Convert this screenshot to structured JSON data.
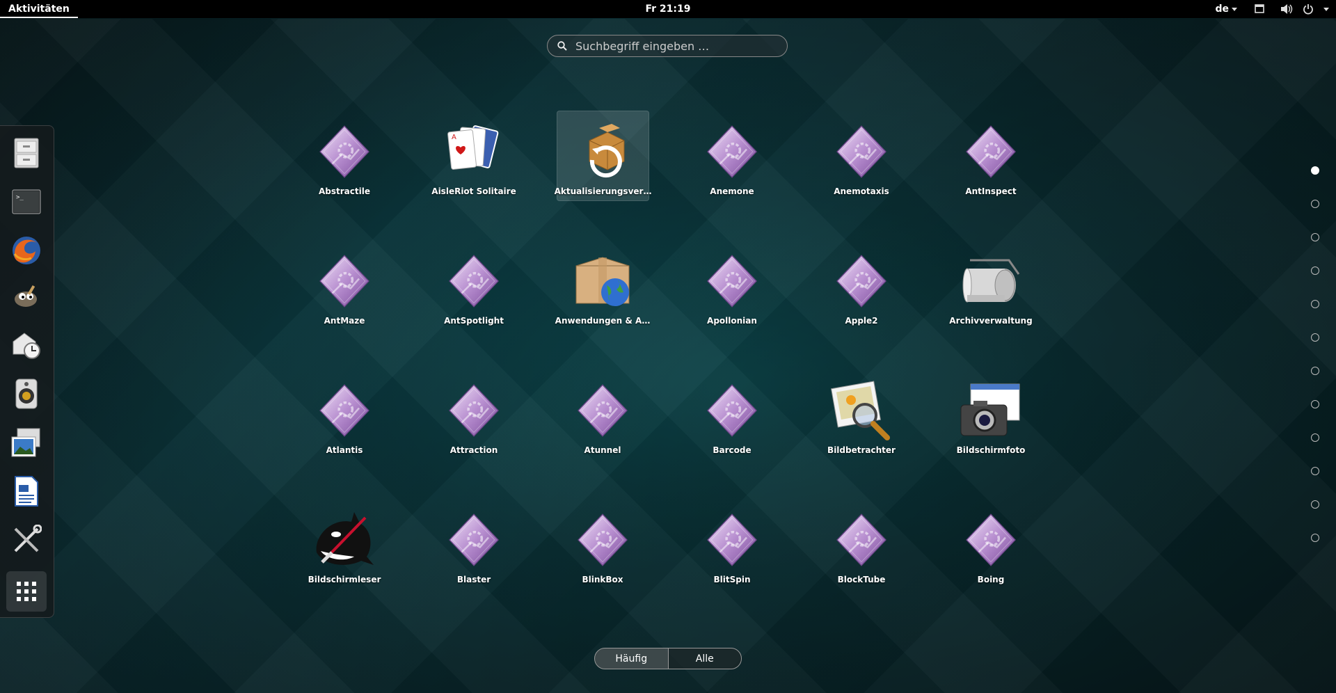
{
  "topbar": {
    "activities": "Aktivitäten",
    "clock": "Fr 21:19",
    "language": "de"
  },
  "search": {
    "placeholder": "Suchbegriff eingeben …"
  },
  "dash": {
    "items": [
      {
        "name": "files",
        "icon": "file-cabinet-icon"
      },
      {
        "name": "terminal",
        "icon": "terminal-icon"
      },
      {
        "name": "firefox",
        "icon": "firefox-icon"
      },
      {
        "name": "gimp",
        "icon": "gimp-icon"
      },
      {
        "name": "evolution",
        "icon": "mail-clock-icon"
      },
      {
        "name": "rhythmbox",
        "icon": "speaker-icon"
      },
      {
        "name": "shotwell",
        "icon": "photos-icon"
      },
      {
        "name": "writer",
        "icon": "document-icon"
      },
      {
        "name": "tools",
        "icon": "tools-icon"
      },
      {
        "name": "show-apps",
        "icon": "app-grid-icon"
      }
    ]
  },
  "apps": [
    {
      "label": "Abstractile",
      "icon": "screensaver-icon"
    },
    {
      "label": "AisleRiot Solitaire",
      "icon": "cards-icon"
    },
    {
      "label": "Aktualisierungsver…",
      "icon": "update-icon"
    },
    {
      "label": "Anemone",
      "icon": "screensaver-icon"
    },
    {
      "label": "Anemotaxis",
      "icon": "screensaver-icon"
    },
    {
      "label": "AntInspect",
      "icon": "screensaver-icon"
    },
    {
      "label": "AntMaze",
      "icon": "screensaver-icon"
    },
    {
      "label": "AntSpotlight",
      "icon": "screensaver-icon"
    },
    {
      "label": "Anwendungen & A…",
      "icon": "package-globe-icon"
    },
    {
      "label": "Apollonian",
      "icon": "screensaver-icon"
    },
    {
      "label": "Apple2",
      "icon": "screensaver-icon"
    },
    {
      "label": "Archivverwaltung",
      "icon": "archive-icon"
    },
    {
      "label": "Atlantis",
      "icon": "screensaver-icon"
    },
    {
      "label": "Attraction",
      "icon": "screensaver-icon"
    },
    {
      "label": "Atunnel",
      "icon": "screensaver-icon"
    },
    {
      "label": "Barcode",
      "icon": "screensaver-icon"
    },
    {
      "label": "Bildbetrachter",
      "icon": "image-viewer-icon"
    },
    {
      "label": "Bildschirmfoto",
      "icon": "camera-icon"
    },
    {
      "label": "Bildschirmleser",
      "icon": "orca-icon"
    },
    {
      "label": "Blaster",
      "icon": "screensaver-icon"
    },
    {
      "label": "BlinkBox",
      "icon": "screensaver-icon"
    },
    {
      "label": "BlitSpin",
      "icon": "screensaver-icon"
    },
    {
      "label": "BlockTube",
      "icon": "screensaver-icon"
    },
    {
      "label": "Boing",
      "icon": "screensaver-icon"
    }
  ],
  "pager": {
    "pages": 12,
    "current": 1
  },
  "view_switch": {
    "frequent": "Häufig",
    "all": "Alle",
    "active": "frequent"
  }
}
